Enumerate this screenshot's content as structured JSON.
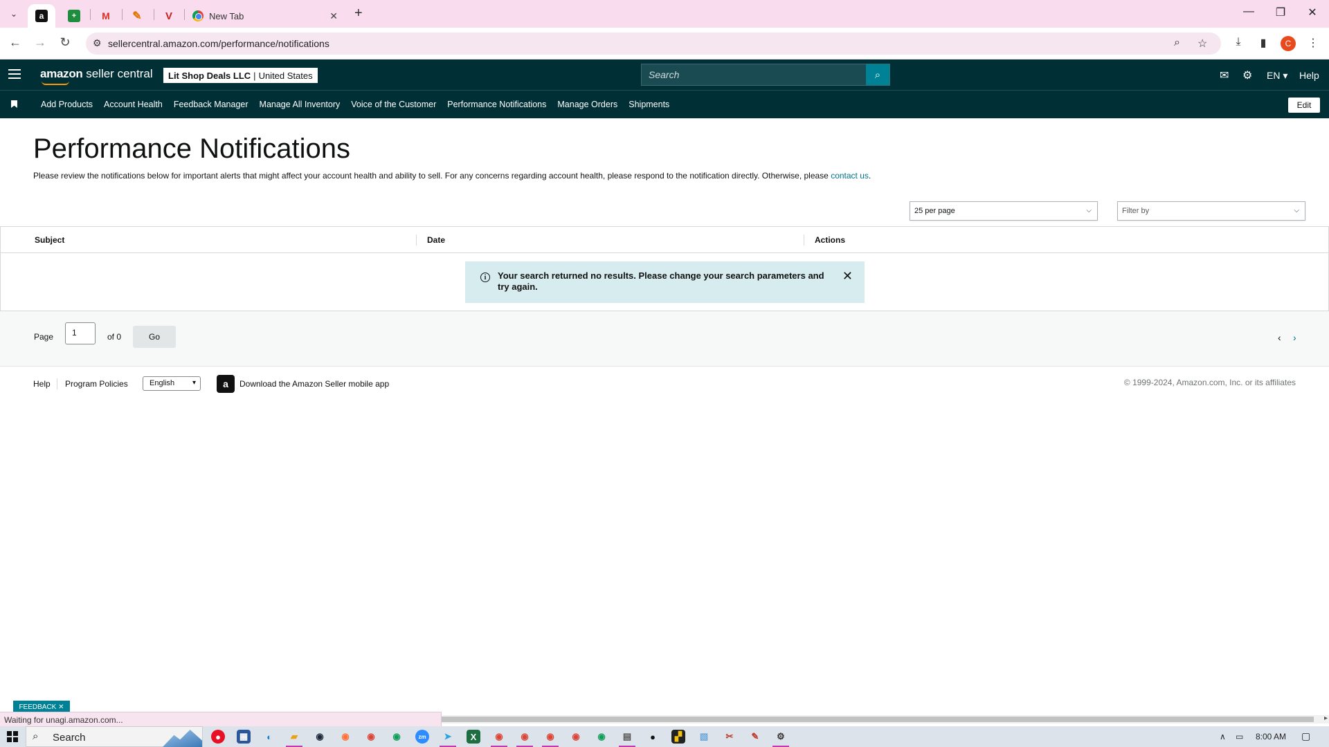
{
  "browser": {
    "tabs": [
      {
        "icon": "a"
      },
      {
        "icon": "+"
      },
      {
        "icon": "M"
      },
      {
        "icon": "✎"
      },
      {
        "icon": "V"
      }
    ],
    "new_tab_title": "New Tab",
    "url": "sellercentral.amazon.com/performance/notifications",
    "profile_initial": "C"
  },
  "header": {
    "logo_bold": "amazon",
    "logo_rest": " seller central",
    "account_name": "Lit Shop Deals LLC",
    "account_sep": "|",
    "account_region": "United States",
    "search_placeholder": "Search",
    "language": "EN",
    "help": "Help"
  },
  "nav": {
    "items": [
      "Add Products",
      "Account Health",
      "Feedback Manager",
      "Manage All Inventory",
      "Voice of the Customer",
      "Performance Notifications",
      "Manage Orders",
      "Shipments"
    ],
    "edit_label": "Edit"
  },
  "page": {
    "title": "Performance Notifications",
    "description": "Please review the notifications below for important alerts that might affect your account health and ability to sell. For any concerns regarding account health, please respond to the notification directly. Otherwise, please ",
    "contact_link": "contact us",
    "description_end": ".",
    "per_page": "25 per page",
    "filter_placeholder": "Filter by"
  },
  "table": {
    "columns": [
      "Subject",
      "Date",
      "Actions"
    ],
    "empty_message": "Your search returned no results. Please change your search parameters and try again."
  },
  "pager": {
    "page_label": "Page",
    "page_value": "1",
    "of_label": "of 0",
    "go_label": "Go"
  },
  "footer": {
    "help": "Help",
    "program_policies": "Program Policies",
    "language": "English",
    "app_text": "Download the Amazon Seller mobile app",
    "copyright": "© 1999-2024, Amazon.com, Inc. or its affiliates"
  },
  "overlay": {
    "feedback_label": "FEEDBACK",
    "status_text": "Waiting for unagi.amazon.com..."
  },
  "taskbar": {
    "search_label": "Search",
    "time": "8:00 AM"
  },
  "colors": {
    "header_bg": "#002f36",
    "accent_teal": "#008296",
    "link": "#007185",
    "alert_bg": "#d6ecee"
  }
}
